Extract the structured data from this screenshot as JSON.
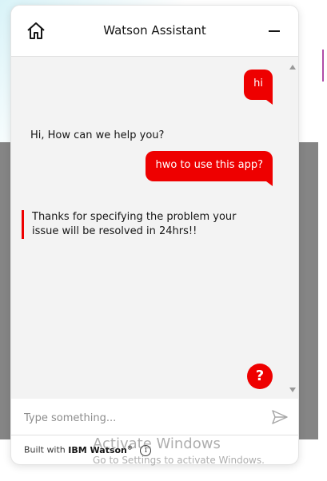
{
  "header": {
    "title": "Watson Assistant"
  },
  "messages": {
    "user1": "hi",
    "bot1": "Hi, How can we help you?",
    "user2": "hwo to use this app?",
    "bot2": "Thanks for specifying the problem your issue will be resolved in 24hrs!!"
  },
  "help_button": {
    "label": "?"
  },
  "input": {
    "placeholder": "Type something...",
    "value": ""
  },
  "footer": {
    "prefix": "Built with",
    "brand": "IBM Watson",
    "brand_mark": "®",
    "info_label": "i"
  },
  "watermark": {
    "title": "Activate Windows",
    "subtitle": "Go to Settings to activate Windows."
  },
  "colors": {
    "accent": "#ee0000",
    "message_area": "#f3f3f3",
    "backdrop": "#858585"
  }
}
